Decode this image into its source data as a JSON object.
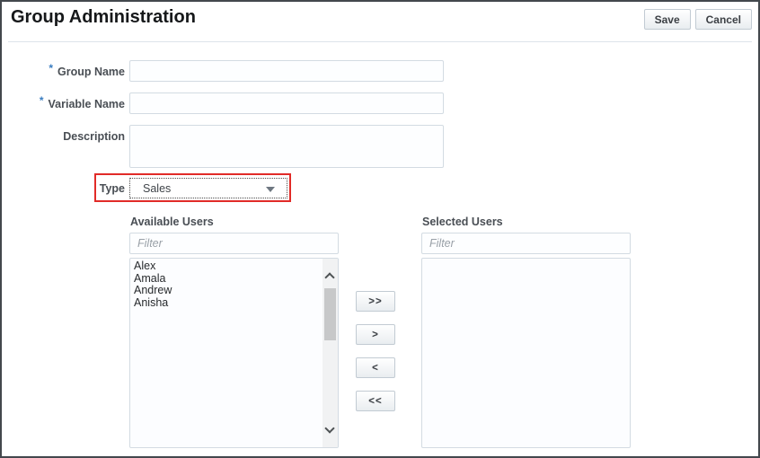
{
  "header": {
    "title": "Group Administration",
    "save_label": "Save",
    "cancel_label": "Cancel"
  },
  "form": {
    "required_marker": "*",
    "group_name": {
      "label": "Group Name",
      "value": "",
      "required": true
    },
    "variable_name": {
      "label": "Variable Name",
      "value": "",
      "required": true
    },
    "description": {
      "label": "Description",
      "value": ""
    },
    "type": {
      "label": "Type",
      "selected_option": "Sales"
    }
  },
  "shuttle": {
    "available": {
      "label": "Available Users",
      "filter_placeholder": "Filter",
      "items": [
        "Alex",
        "Amala",
        "Andrew",
        "Anisha"
      ]
    },
    "selected": {
      "label": "Selected Users",
      "filter_placeholder": "Filter",
      "items": []
    },
    "buttons": {
      "move_all_right": ">>",
      "move_right": ">",
      "move_left": "<",
      "move_all_left": "<<"
    }
  },
  "colors": {
    "highlight_red": "#e12b28",
    "required_blue": "#3a7dc0"
  }
}
